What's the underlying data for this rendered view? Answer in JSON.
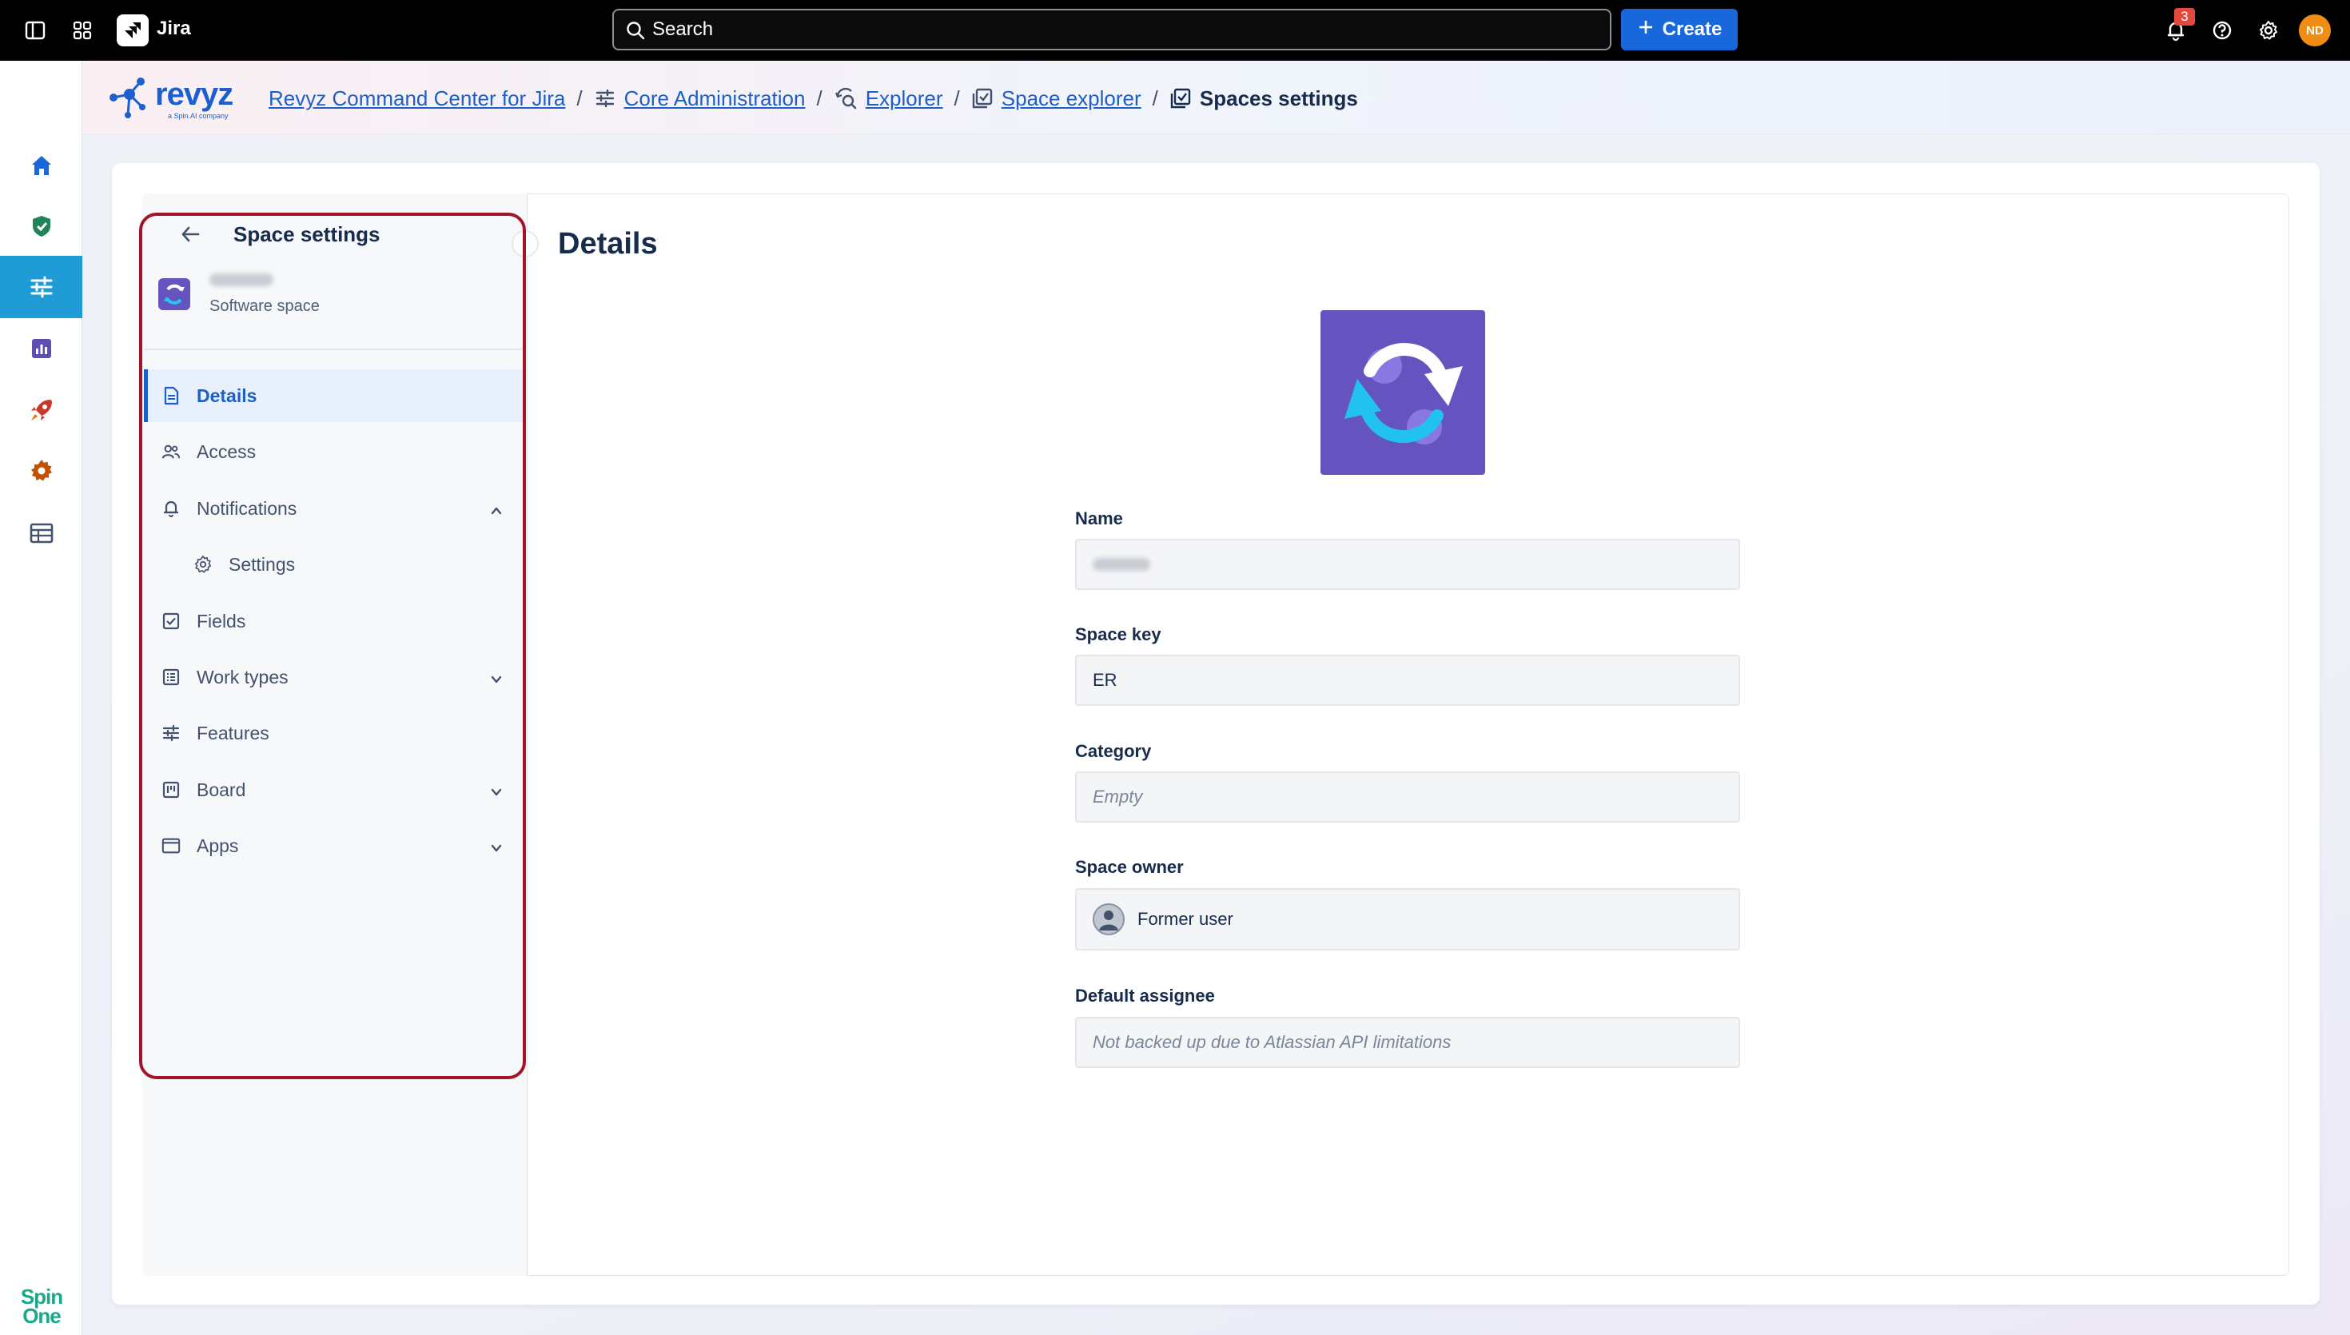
{
  "topbar": {
    "app_name": "Jira",
    "search_placeholder": "Search",
    "create_label": "Create",
    "notification_count": "3",
    "user_initials": "ND"
  },
  "header": {
    "logo_text": "revyz",
    "logo_subtext": "a Spin.AI company",
    "breadcrumbs": [
      {
        "label": "Revyz Command Center for Jira",
        "icon": "none"
      },
      {
        "label": "Core Administration",
        "icon": "sliders-icon"
      },
      {
        "label": "Explorer",
        "icon": "explorer-icon"
      },
      {
        "label": "Space explorer",
        "icon": "space-icon"
      },
      {
        "label": "Spaces settings",
        "icon": "space-icon"
      }
    ]
  },
  "rail": {
    "items": [
      "home-icon",
      "shield-check-icon",
      "sliders-icon",
      "report-icon",
      "rocket-icon",
      "gear-icon",
      "table-icon"
    ],
    "footer_logo": [
      "Spin",
      "One"
    ]
  },
  "sidebar": {
    "title": "Space settings",
    "space_type": "Software space",
    "items": [
      {
        "label": "Details",
        "icon": "page-icon",
        "active": true
      },
      {
        "label": "Access",
        "icon": "people-icon"
      },
      {
        "label": "Notifications",
        "icon": "bell-icon",
        "expanded": true
      },
      {
        "label": "Settings",
        "icon": "gear-icon",
        "sub": true
      },
      {
        "label": "Fields",
        "icon": "checkbox-icon"
      },
      {
        "label": "Work types",
        "icon": "list-icon",
        "expandable": true
      },
      {
        "label": "Features",
        "icon": "sliders-icon"
      },
      {
        "label": "Board",
        "icon": "board-icon",
        "expandable": true
      },
      {
        "label": "Apps",
        "icon": "window-icon",
        "expandable": true
      }
    ]
  },
  "details": {
    "title": "Details",
    "fields": {
      "name": {
        "label": "Name",
        "value": ""
      },
      "space_key": {
        "label": "Space key",
        "value": "ER"
      },
      "category": {
        "label": "Category",
        "placeholder": "Empty"
      },
      "space_owner": {
        "label": "Space owner",
        "value": "Former user"
      },
      "default_assignee": {
        "label": "Default assignee",
        "placeholder": "Not backed up due to Atlassian API limitations"
      }
    }
  },
  "colors": {
    "accent": "#1c5fc9",
    "create_button": "#1868db",
    "space_logo": "#6554c0",
    "highlight_border": "#a21529",
    "rail_active": "#1f9bd6"
  }
}
